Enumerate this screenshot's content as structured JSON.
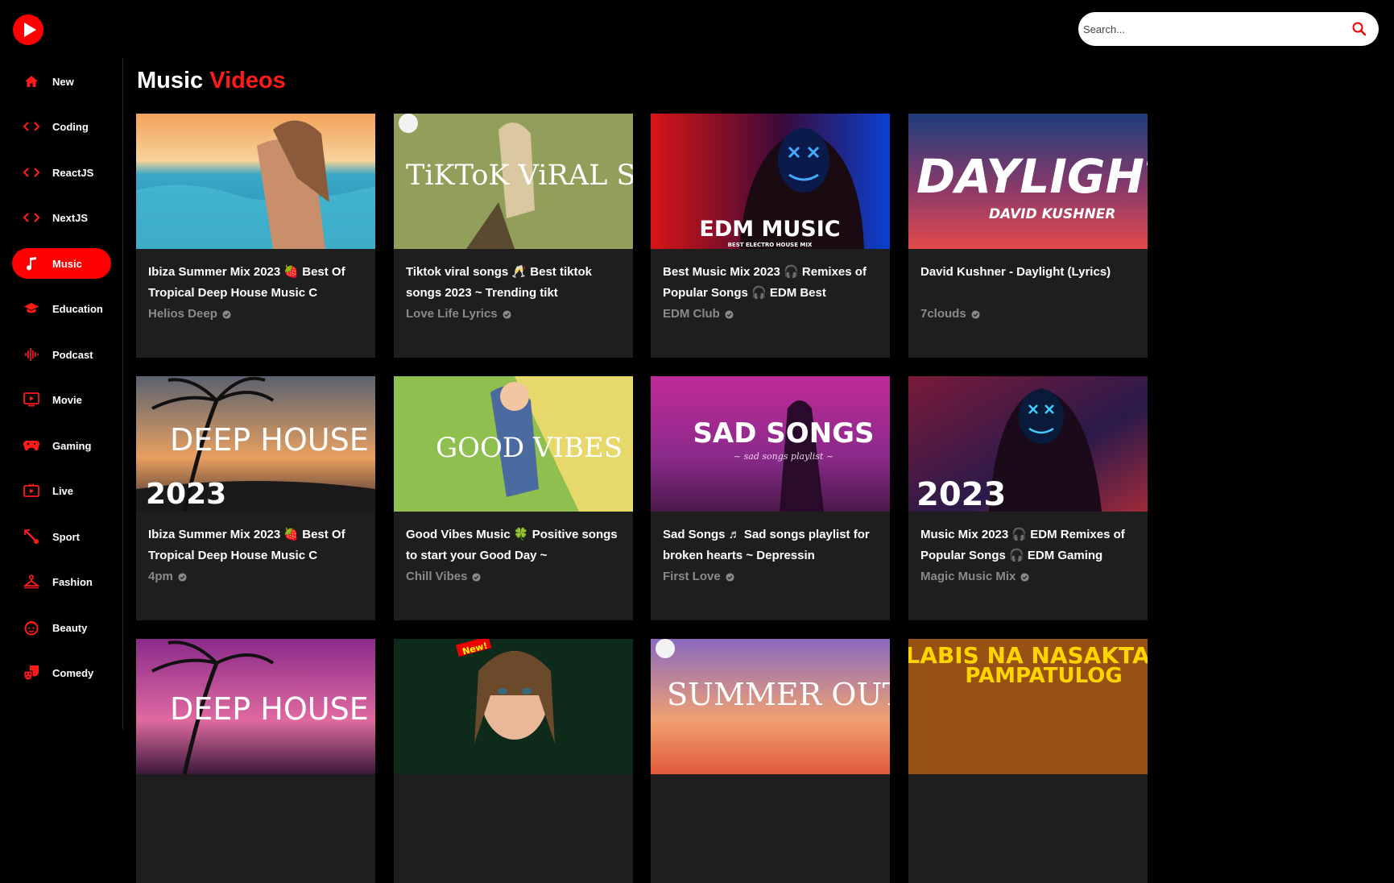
{
  "brand": {
    "accent": "#ff0000",
    "logo_icon": "youtube-play-logo-icon"
  },
  "search": {
    "placeholder": "Search...",
    "icon": "search-icon"
  },
  "sidebar": {
    "items": [
      {
        "label": "New",
        "icon": "home-icon",
        "active": false
      },
      {
        "label": "Coding",
        "icon": "code-icon",
        "active": false
      },
      {
        "label": "ReactJS",
        "icon": "code-icon",
        "active": false
      },
      {
        "label": "NextJS",
        "icon": "code-icon",
        "active": false
      },
      {
        "label": "Music",
        "icon": "music-note-icon",
        "active": true
      },
      {
        "label": "Education",
        "icon": "graduation-cap-icon",
        "active": false
      },
      {
        "label": "Podcast",
        "icon": "sound-wave-icon",
        "active": false
      },
      {
        "label": "Movie",
        "icon": "video-screen-icon",
        "active": false
      },
      {
        "label": "Gaming",
        "icon": "gamepad-icon",
        "active": false
      },
      {
        "label": "Live",
        "icon": "live-tv-icon",
        "active": false
      },
      {
        "label": "Sport",
        "icon": "sport-icon",
        "active": false
      },
      {
        "label": "Fashion",
        "icon": "hanger-icon",
        "active": false
      },
      {
        "label": "Beauty",
        "icon": "beauty-face-icon",
        "active": false
      },
      {
        "label": "Comedy",
        "icon": "comedy-masks-icon",
        "active": false
      }
    ]
  },
  "main": {
    "title_prefix": "Music",
    "title_accent": "Videos",
    "videos": [
      {
        "title": "Ibiza Summer Mix 2023 🍓 Best Of Tropical Deep House Music C",
        "channel": "Helios Deep",
        "thumb_text": ""
      },
      {
        "title": "Tiktok viral songs 🥂 Best tiktok songs 2023 ~ Trending tikt",
        "channel": "Love Life Lyrics",
        "thumb_text": "TiKToK ViRAL SONG"
      },
      {
        "title": "Best Music Mix 2023 🎧 Remixes of Popular Songs 🎧 EDM Best",
        "channel": "EDM Club",
        "thumb_text": "EDM MUSIC",
        "thumb_sub": "BEST ELECTRO HOUSE MIX"
      },
      {
        "title": "David Kushner - Daylight (Lyrics)",
        "channel": "7clouds",
        "thumb_text": "DAYLIGHT",
        "thumb_sub": "DAVID KUSHNER"
      },
      {
        "title": "Ibiza Summer Mix 2023 🍓 Best Of Tropical Deep House Music C",
        "channel": "4pm",
        "thumb_text": "DEEP HOUSE",
        "thumb_sub": "2023"
      },
      {
        "title": "Good Vibes Music 🍀 Positive songs to start your Good Day ~",
        "channel": "Chill Vibes",
        "thumb_text": "GOOD VIBES MUSIC"
      },
      {
        "title": "Sad Songs ♬ Sad songs playlist for broken hearts ~ Depressin",
        "channel": "First Love",
        "thumb_text": "SAD SONGS",
        "thumb_sub": "~ sad songs playlist ~"
      },
      {
        "title": "Music Mix 2023 🎧 EDM Remixes of Popular Songs 🎧 EDM Gaming",
        "channel": "Magic Music Mix",
        "thumb_text": "2023"
      },
      {
        "title": "",
        "channel": "",
        "thumb_text": "DEEP HOUSE"
      },
      {
        "title": "",
        "channel": "",
        "thumb_text": "New!"
      },
      {
        "title": "",
        "channel": "",
        "thumb_text": "SUMMER OUT LOU"
      },
      {
        "title": "",
        "channel": "",
        "thumb_text": "LABIS NA NASAKTA",
        "thumb_sub": "PAMPATULOG"
      }
    ]
  }
}
